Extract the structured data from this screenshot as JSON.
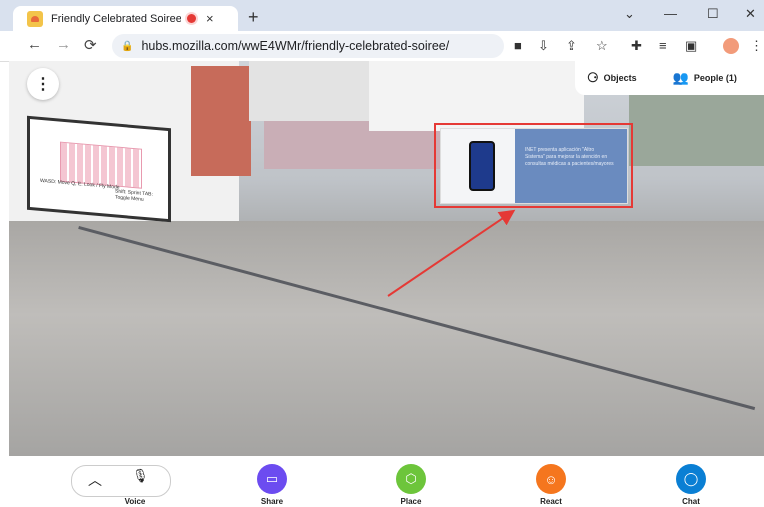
{
  "browser": {
    "tab_title": "Friendly Celebrated Soiree | ",
    "tab_close": "×",
    "new_tab": "+",
    "url": "hubs.mozilla.com/wwE4WMr/friendly-celebrated-soiree/",
    "win_min": "—",
    "win_max": "☐",
    "win_close": "✕"
  },
  "hud": {
    "objects_label": "Objects",
    "people_label": "People (1)"
  },
  "whiteboard": {
    "left_caption": "WASD: Move\nQ, E: Look / Fly Mode",
    "right_caption": "Shift: Sprint\nTAB: Toggle Menu"
  },
  "slide": {
    "text": "INET presenta aplicación \"Altro Sistema\" para mejorar la atención en consultas médicas a pacientes/mayores"
  },
  "toolbar": {
    "voice": "Voice",
    "share": "Share",
    "place": "Place",
    "react": "React",
    "chat": "Chat"
  },
  "colors": {
    "share": "#6c4cf0",
    "place": "#6dc53b",
    "react": "#f5761e",
    "chat": "#0a7fd4",
    "highlight": "#e53935"
  }
}
